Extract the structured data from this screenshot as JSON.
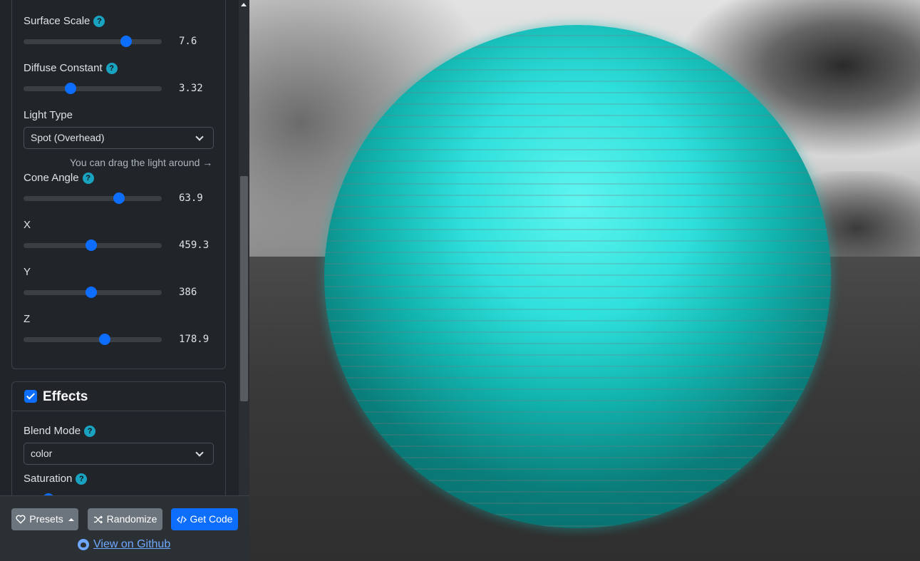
{
  "sidebar": {
    "light": {
      "surface_scale": {
        "label": "Surface Scale",
        "value": "7.6",
        "fraction": 0.74
      },
      "diffuse_constant": {
        "label": "Diffuse Constant",
        "value": "3.32",
        "fraction": 0.34
      },
      "light_type": {
        "label": "Light Type",
        "selected": "Spot (Overhead)"
      },
      "drag_hint": "You can drag the light around →",
      "cone_angle": {
        "label": "Cone Angle",
        "value": "63.9",
        "fraction": 0.69
      },
      "x": {
        "label": "X",
        "value": "459.3",
        "fraction": 0.49
      },
      "y": {
        "label": "Y",
        "value": "386",
        "fraction": 0.49
      },
      "z": {
        "label": "Z",
        "value": "178.9",
        "fraction": 0.59
      }
    },
    "effects": {
      "title": "Effects",
      "enabled": true,
      "blend_mode": {
        "label": "Blend Mode",
        "selected": "color"
      },
      "saturation": {
        "label": "Saturation"
      }
    },
    "help_glyph": "?"
  },
  "footer": {
    "presets_label": "Presets",
    "randomize_label": "Randomize",
    "get_code_label": "Get Code",
    "github_label": "View on Github"
  },
  "icons": {
    "presets": "heart-icon",
    "randomize": "shuffle-icon",
    "get_code": "code-icon",
    "github": "github-icon"
  },
  "colors": {
    "accent": "#0d6efd",
    "help": "#1aa2c1",
    "light_color": "#2fe0dc"
  }
}
